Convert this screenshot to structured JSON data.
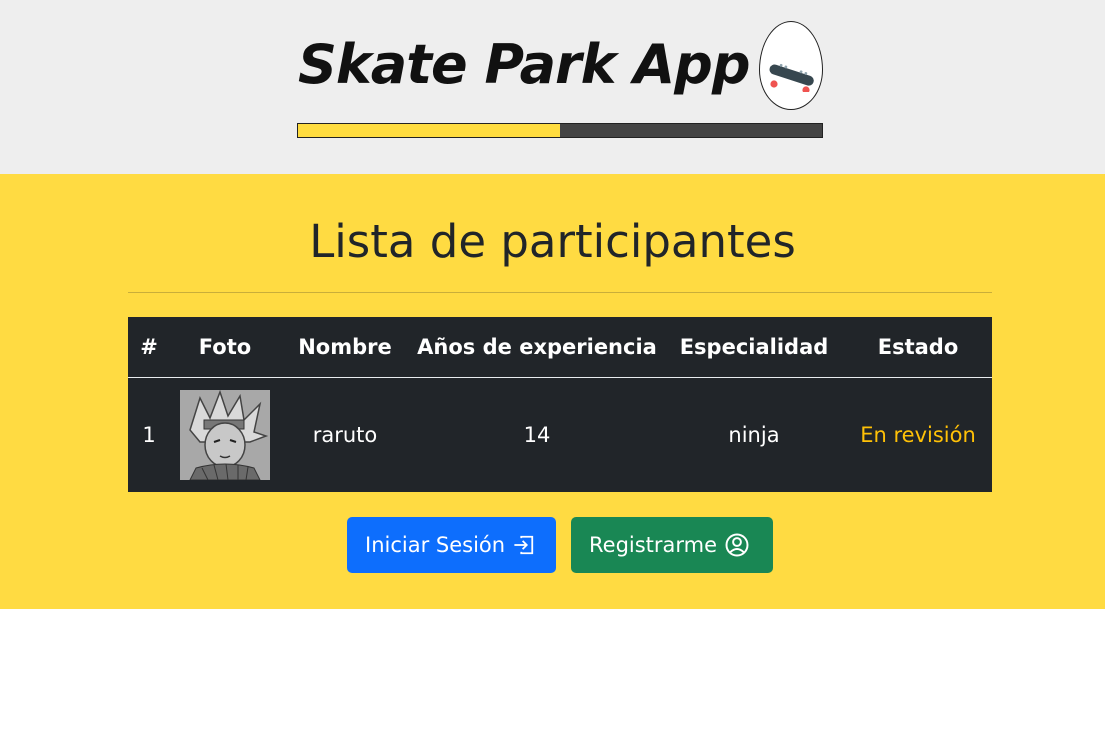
{
  "header": {
    "app_title": "Skate Park App",
    "logo_icon": "skateboard-icon",
    "progress_fraction": 0.5
  },
  "main": {
    "title": "Lista de participantes",
    "table": {
      "headers": [
        "#",
        "Foto",
        "Nombre",
        "Años de experiencia",
        "Especialidad",
        "Estado"
      ],
      "rows": [
        {
          "num": "1",
          "foto_icon": "participant-photo",
          "nombre": "raruto",
          "anos": "14",
          "especialidad": "ninja",
          "estado": "En revisión"
        }
      ]
    },
    "buttons": {
      "login_label": "Iniciar Sesión",
      "login_icon": "box-arrow-in-right-icon",
      "register_label": "Registrarme",
      "register_icon": "person-circle-icon"
    }
  },
  "colors": {
    "header_bg": "#eeeeee",
    "main_bg": "#ffdb42",
    "table_bg": "#212529",
    "status_warning": "#ffc107",
    "primary": "#0d6efd",
    "success": "#198754"
  }
}
